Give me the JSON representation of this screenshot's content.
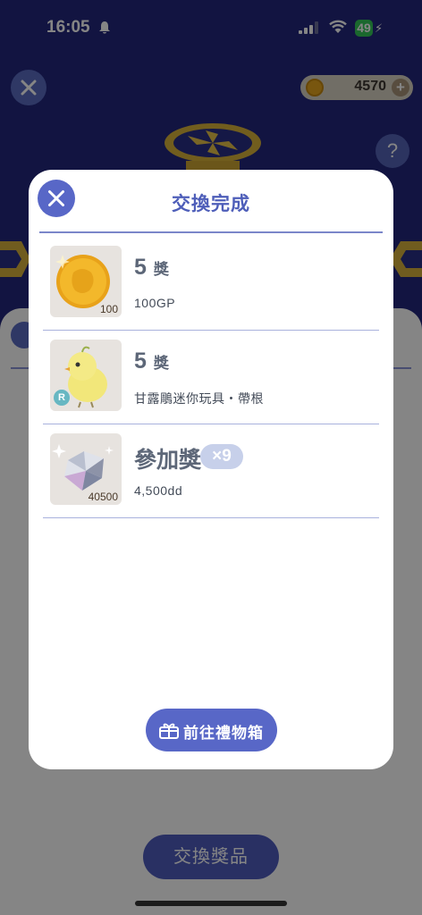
{
  "status_bar": {
    "time": "16:05",
    "battery": "49",
    "icons": [
      "bell-slash-icon",
      "signal-icon",
      "wifi-icon",
      "battery-icon",
      "bolt-icon"
    ]
  },
  "background": {
    "coin_balance": "4570",
    "help_label": "?",
    "exchange_button_label": "交換獎品"
  },
  "modal": {
    "title": "交換完成",
    "items": [
      {
        "title": "5",
        "unit": "獎",
        "description": "100GP",
        "thumb_count": "100",
        "thumb_icon": "gold-coin-icon"
      },
      {
        "title": "5",
        "unit": "獎",
        "description": "甘露鵰迷你玩具・帶根",
        "rarity": "R",
        "thumb_icon": "yellow-bird-toy-icon"
      },
      {
        "title": "參加獎",
        "quantity": "×9",
        "description": "4,500dd",
        "thumb_count": "40500",
        "thumb_icon": "diamond-icon"
      }
    ],
    "gift_button_label": "前往禮物箱"
  },
  "colors": {
    "accent": "#5867c7",
    "title": "#4e5eb9",
    "background_dark": "#23277d"
  }
}
